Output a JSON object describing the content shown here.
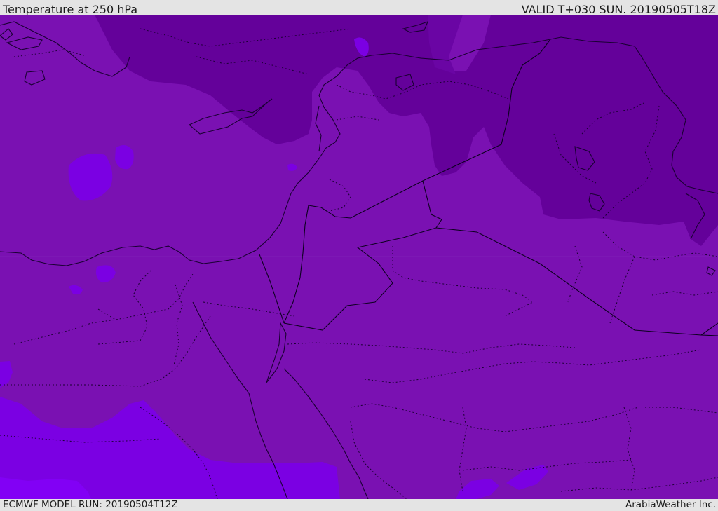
{
  "header": {
    "title": "Temperature at 250 hPa",
    "valid": "VALID T+030 SUN. 20190505T18Z"
  },
  "footer": {
    "model_run": "ECMWF MODEL RUN: 20190504T12Z",
    "credit": "ArabiaWeather Inc."
  },
  "map": {
    "colors": {
      "base": "#7a11b2",
      "cold": "#64019a",
      "warm": "#7b00e3",
      "warmest": "#8200f5",
      "coast": "#1a0033",
      "border": "#0d0020"
    }
  }
}
